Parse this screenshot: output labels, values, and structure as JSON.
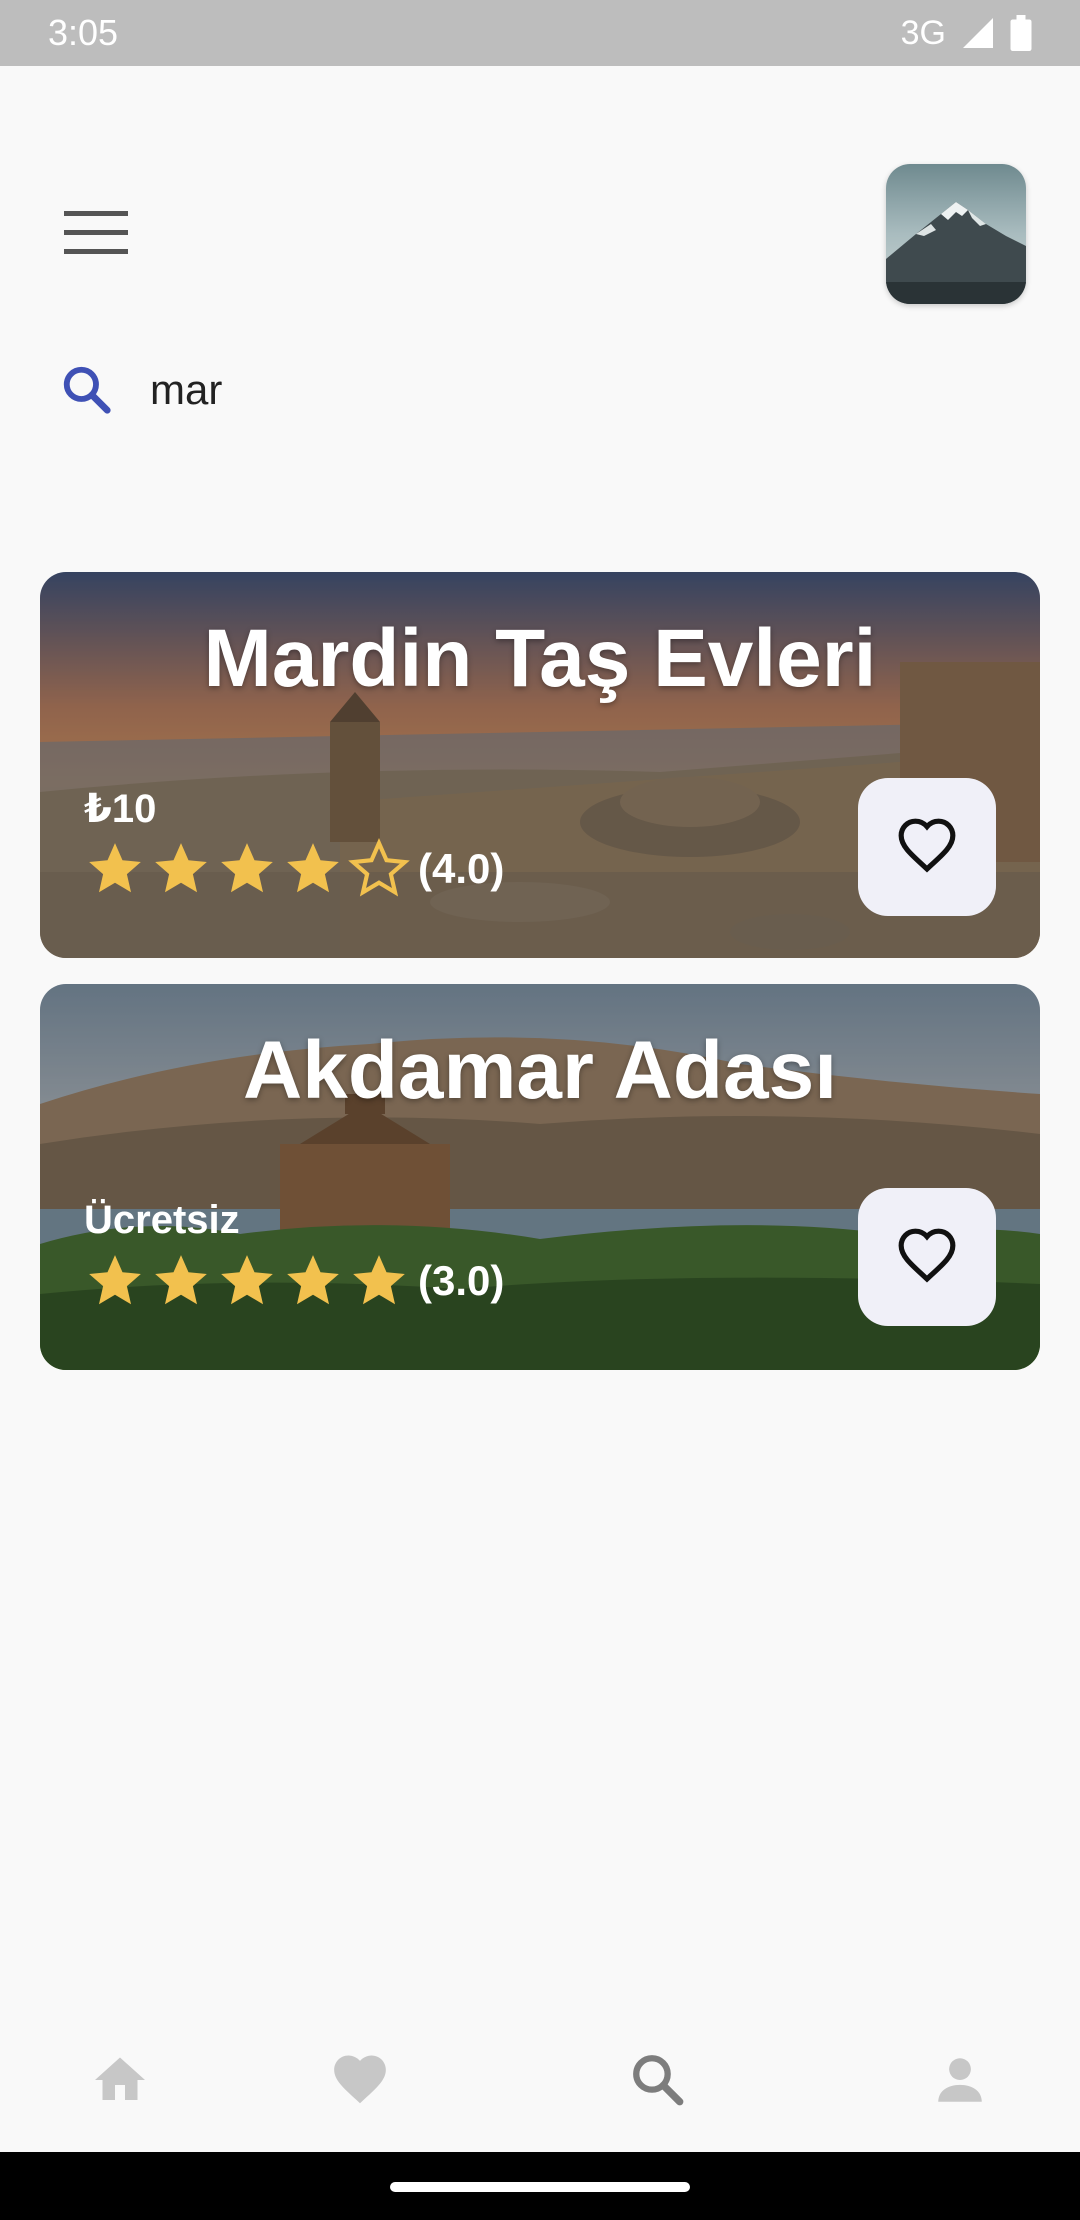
{
  "status_bar": {
    "time": "3:05",
    "network": "3G"
  },
  "header": {
    "menu_icon": "hamburger-menu-icon",
    "avatar_icon": "mountain-avatar-image"
  },
  "search": {
    "icon": "search-icon",
    "value": "mar",
    "accent_color": "#3f51b5"
  },
  "results": [
    {
      "title": "Mardin Taş Evleri",
      "price": "₺10",
      "rating_text": "(4.0)",
      "stars_filled": 4,
      "stars_total": 5,
      "favorite_icon": "heart-outline-icon"
    },
    {
      "title": "Akdamar Adası",
      "price": "Ücretsiz",
      "rating_text": "(3.0)",
      "stars_filled": 5,
      "stars_total": 5,
      "favorite_icon": "heart-outline-icon"
    }
  ],
  "bottom_nav": {
    "items": [
      {
        "name": "home",
        "icon": "home-icon"
      },
      {
        "name": "favorites",
        "icon": "heart-icon"
      },
      {
        "name": "search",
        "icon": "search-icon",
        "active": true
      },
      {
        "name": "profile",
        "icon": "person-icon"
      }
    ]
  },
  "colors": {
    "star": "#f2c14e",
    "nav_inactive": "#c7c7c7",
    "nav_active": "#7d7d7d",
    "status_bar": "#bdbdbd",
    "fav_button_bg": "#f0f0f8"
  }
}
